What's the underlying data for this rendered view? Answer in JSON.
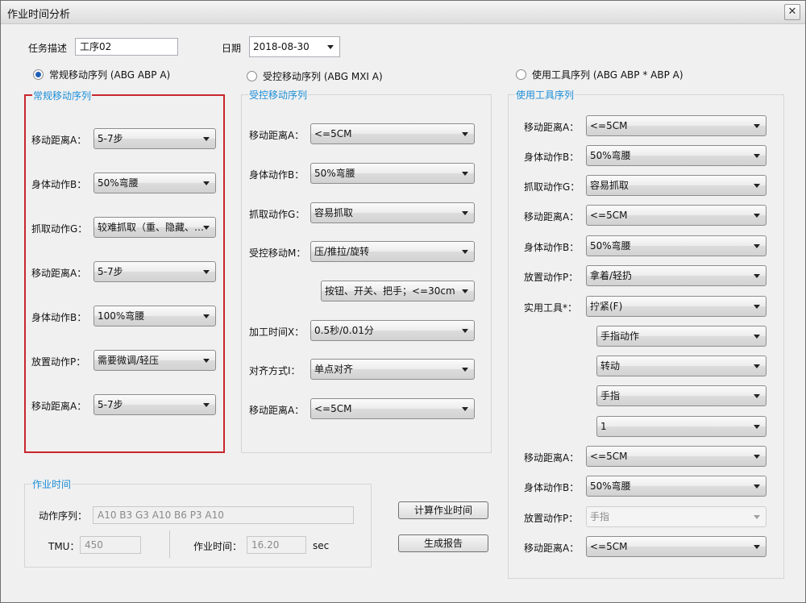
{
  "window": {
    "title": "作业时间分析",
    "close_glyph": "✕"
  },
  "task": {
    "label": "任务描述",
    "value": "工序02"
  },
  "date": {
    "label": "日期",
    "value": "2018-08-30"
  },
  "mode_radios": [
    {
      "label": "常规移动序列 (ABG ABP A)",
      "checked": true
    },
    {
      "label": "受控移动序列 (ABG MXI A)",
      "checked": false
    },
    {
      "label": "使用工具序列 (ABG ABP * ABP A)",
      "checked": false
    }
  ],
  "group_general": {
    "title": "常规移动序列",
    "border_color": "#c8262c",
    "rows": [
      {
        "label": "移动距离A：",
        "value": "5-7步"
      },
      {
        "label": "身体动作B：",
        "value": "50%弯腰"
      },
      {
        "label": "抓取动作G：",
        "value": "较难抓取（重、隐藏、…"
      },
      {
        "label": "移动距离A：",
        "value": "5-7步"
      },
      {
        "label": "身体动作B：",
        "value": "100%弯腰"
      },
      {
        "label": "放置动作P：",
        "value": "需要微调/轻压"
      },
      {
        "label": "移动距离A：",
        "value": "5-7步"
      }
    ]
  },
  "group_controlled": {
    "title": "受控移动序列",
    "rows": [
      {
        "label": "移动距离A：",
        "value": "<=5CM"
      },
      {
        "label": "身体动作B：",
        "value": "50%弯腰"
      },
      {
        "label": "抓取动作G：",
        "value": "容易抓取"
      },
      {
        "label": "受控移动M：",
        "value": "压/推拉/旋转"
      },
      {
        "label": "",
        "value": "按钮、开关、把手；<=30cm"
      },
      {
        "label": "加工时间X：",
        "value": "0.5秒/0.01分"
      },
      {
        "label": "对齐方式I：",
        "value": "单点对齐"
      },
      {
        "label": "移动距离A：",
        "value": "<=5CM"
      }
    ]
  },
  "group_tool": {
    "title": "使用工具序列",
    "rows": [
      {
        "label": "移动距离A：",
        "value": "<=5CM",
        "disabled": false
      },
      {
        "label": "身体动作B：",
        "value": "50%弯腰",
        "disabled": false
      },
      {
        "label": "抓取动作G：",
        "value": "容易抓取",
        "disabled": false
      },
      {
        "label": "移动距离A：",
        "value": "<=5CM",
        "disabled": false
      },
      {
        "label": "身体动作B：",
        "value": "50%弯腰",
        "disabled": false
      },
      {
        "label": "放置动作P：",
        "value": "拿着/轻扔",
        "disabled": false
      },
      {
        "label": "实用工具*：",
        "value": "拧紧(F)",
        "disabled": false
      },
      {
        "label": "",
        "value": "手指动作",
        "disabled": false
      },
      {
        "label": "",
        "value": "转动",
        "disabled": false
      },
      {
        "label": "",
        "value": "手指",
        "disabled": false
      },
      {
        "label": "",
        "value": "1",
        "disabled": false
      },
      {
        "label": "移动距离A：",
        "value": "<=5CM",
        "disabled": false
      },
      {
        "label": "身体动作B：",
        "value": "50%弯腰",
        "disabled": false
      },
      {
        "label": "放置动作P：",
        "value": "手指",
        "disabled": true
      },
      {
        "label": "移动距离A：",
        "value": "<=5CM",
        "disabled": false
      }
    ]
  },
  "worktime": {
    "title": "作业时间",
    "sequence_label": "动作序列：",
    "sequence_value": "A10 B3 G3 A10 B6 P3 A10",
    "tmu_label": "TMU：",
    "tmu_value": "450",
    "time_label": "作业时间：",
    "time_value": "16.20",
    "unit": "sec"
  },
  "buttons": {
    "calc": "计算作业时间",
    "report": "生成报告"
  }
}
